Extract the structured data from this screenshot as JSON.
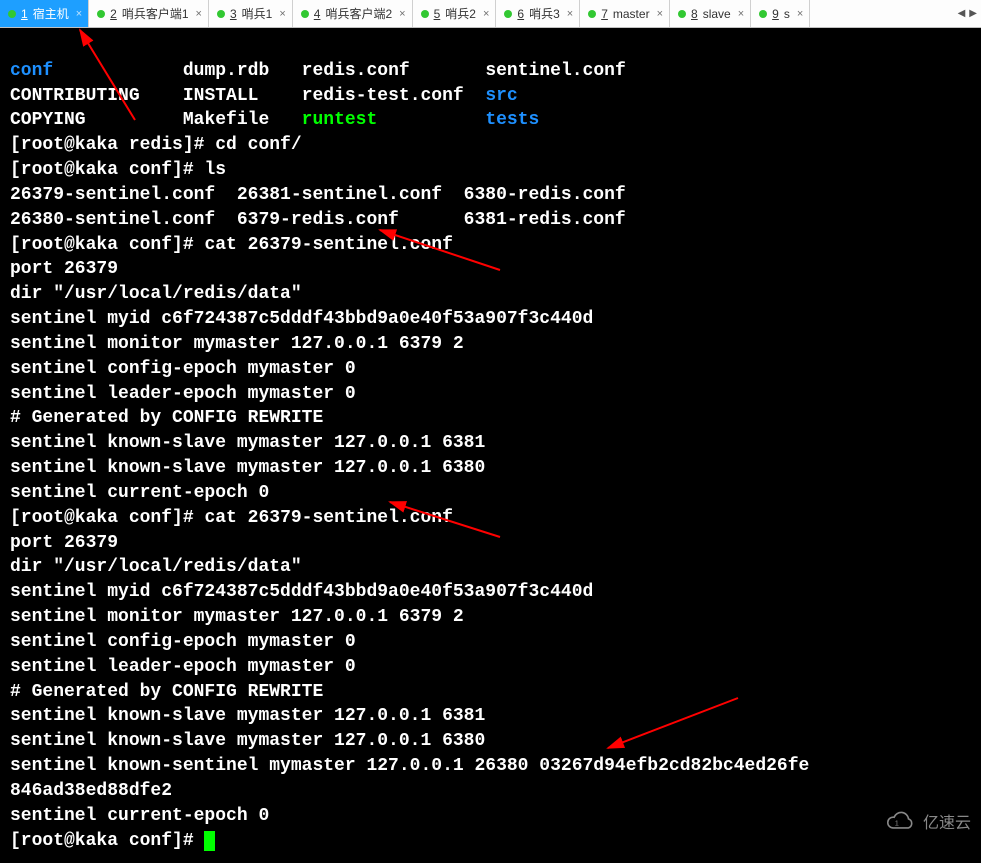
{
  "tabs": [
    {
      "num": "1",
      "label": "宿主机",
      "active": true
    },
    {
      "num": "2",
      "label": "哨兵客户端1",
      "active": false
    },
    {
      "num": "3",
      "label": "哨兵1",
      "active": false
    },
    {
      "num": "4",
      "label": "哨兵客户端2",
      "active": false
    },
    {
      "num": "5",
      "label": "哨兵2",
      "active": false
    },
    {
      "num": "6",
      "label": "哨兵3",
      "active": false
    },
    {
      "num": "7",
      "label": "master",
      "active": false
    },
    {
      "num": "8",
      "label": "slave",
      "active": false
    },
    {
      "num": "9",
      "label": "s",
      "active": false
    }
  ],
  "ls_row1": {
    "c1": "conf",
    "c2": "dump.rdb",
    "c3": "redis.conf",
    "c4": "sentinel.conf"
  },
  "ls_row2": {
    "c1": "CONTRIBUTING",
    "c2": "INSTALL",
    "c3": "redis-test.conf",
    "c4": "src"
  },
  "ls_row3": {
    "c1": "COPYING",
    "c2": "Makefile",
    "c3": "runtest",
    "c4": "tests"
  },
  "prompt_redis": "[root@kaka redis]#",
  "prompt_conf": "[root@kaka conf]#",
  "cmd_cd": "cd conf/",
  "cmd_ls": "ls",
  "cmd_cat": "cat 26379-sentinel.conf",
  "conf_ls_l1": "26379-sentinel.conf  26381-sentinel.conf  6380-redis.conf",
  "conf_ls_l2": "26380-sentinel.conf  6379-redis.conf      6381-redis.conf",
  "cat1": {
    "l1": "port 26379",
    "l2": "dir \"/usr/local/redis/data\"",
    "l3": "sentinel myid c6f724387c5dddf43bbd9a0e40f53a907f3c440d",
    "l4": "sentinel monitor mymaster 127.0.0.1 6379 2",
    "l5": "sentinel config-epoch mymaster 0",
    "l6": "sentinel leader-epoch mymaster 0",
    "l7": "# Generated by CONFIG REWRITE",
    "l8": "sentinel known-slave mymaster 127.0.0.1 6381",
    "l9": "sentinel known-slave mymaster 127.0.0.1 6380",
    "l10": "sentinel current-epoch 0"
  },
  "cat2": {
    "l1": "port 26379",
    "l2": "dir \"/usr/local/redis/data\"",
    "l3": "sentinel myid c6f724387c5dddf43bbd9a0e40f53a907f3c440d",
    "l4": "sentinel monitor mymaster 127.0.0.1 6379 2",
    "l5": "sentinel config-epoch mymaster 0",
    "l6": "sentinel leader-epoch mymaster 0",
    "l7": "# Generated by CONFIG REWRITE",
    "l8": "sentinel known-slave mymaster 127.0.0.1 6381",
    "l9": "sentinel known-slave mymaster 127.0.0.1 6380",
    "l10": "sentinel known-sentinel mymaster 127.0.0.1 26380 03267d94efb2cd82bc4ed26fe",
    "l11": "846ad38ed88dfe2",
    "l12": "sentinel current-epoch 0"
  },
  "watermark": "亿速云"
}
